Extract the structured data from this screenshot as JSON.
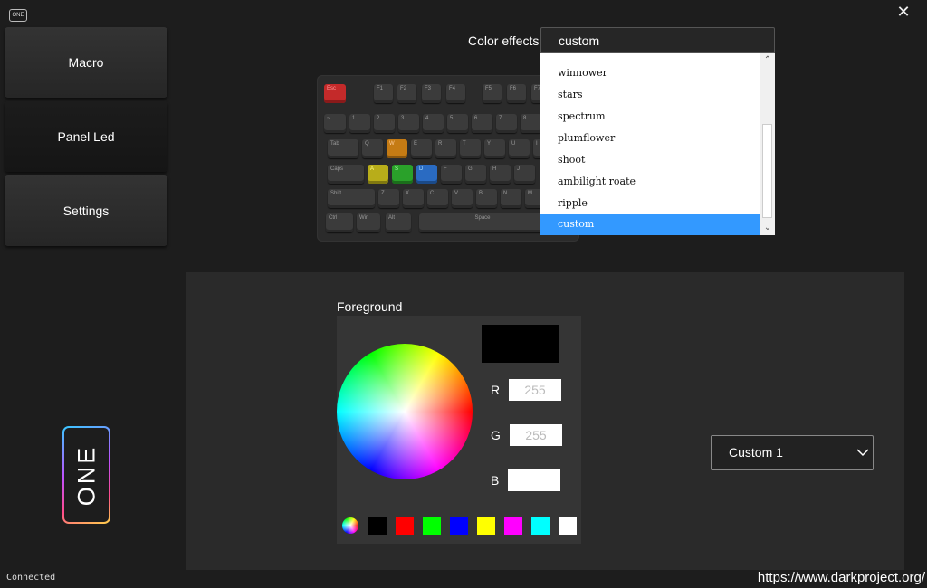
{
  "app": {
    "logo_text": "ONE",
    "close_symbol": "✕"
  },
  "sidebar": {
    "items": [
      {
        "label": "Macro"
      },
      {
        "label": "Panel Led"
      },
      {
        "label": "Settings"
      }
    ],
    "active_index": 1
  },
  "brand": {
    "badge_text": "ONE"
  },
  "status": {
    "connection": "Connected",
    "url": "https://www.darkproject.org/"
  },
  "color_effects": {
    "label": "Color effects",
    "selected": "custom",
    "options": [
      "winnower",
      "stars",
      "spectrum",
      "plumflower",
      "shoot",
      "ambilight roate",
      "ripple",
      "custom"
    ]
  },
  "keyboard": {
    "row0": [
      "Esc",
      "",
      "F1",
      "F2",
      "F3",
      "F4",
      "F5",
      "F6",
      "F7"
    ],
    "row1": [
      "~",
      "1",
      "2",
      "3",
      "4",
      "5",
      "6",
      "7",
      "8"
    ],
    "row2": [
      "Tab",
      "Q",
      "W",
      "E",
      "R",
      "T",
      "Y",
      "U",
      "I"
    ],
    "row3": [
      "Caps",
      "A",
      "S",
      "D",
      "F",
      "G",
      "H",
      "J"
    ],
    "row4": [
      "Shift",
      "Z",
      "X",
      "C",
      "V",
      "B",
      "N",
      "M"
    ],
    "row5": [
      "Ctrl",
      "Win",
      "Alt",
      "Space"
    ]
  },
  "foreground": {
    "label": "Foreground",
    "preview_color": "#000000",
    "r_label": "R",
    "r_value": "255",
    "g_label": "G",
    "g_value": "255",
    "b_label": "B",
    "b_value": "",
    "swatches": [
      "#000000",
      "#ff0000",
      "#00ff00",
      "#0000ff",
      "#ffff00",
      "#ff00ff",
      "#00ffff",
      "#ffffff"
    ]
  },
  "profile_select": {
    "value": "Custom 1"
  },
  "colors": {
    "accent": "#3399ff",
    "background": "#1d1d1d",
    "panel": "#2a2a2a"
  }
}
